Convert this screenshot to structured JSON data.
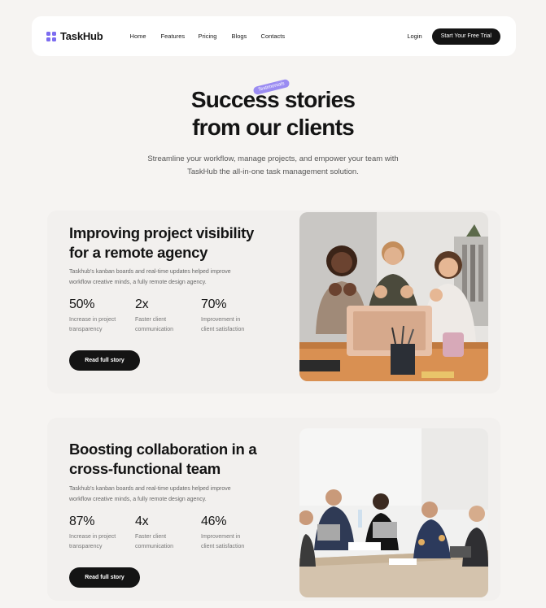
{
  "nav": {
    "logo_text": "TaskHub",
    "links": [
      "Home",
      "Features",
      "Pricing",
      "Blogs",
      "Contacts"
    ],
    "login": "Login",
    "cta": "Start Your Free Trial"
  },
  "hero": {
    "badge": "Testimonials",
    "title_line1": "Success stories",
    "title_line2": "from our clients",
    "subtitle_line1": "Streamline your workflow, manage projects, and empower your team with",
    "subtitle_line2": "TaskHub the all-in-one task management solution."
  },
  "stories": [
    {
      "title_line1": "Improving project visibility",
      "title_line2": "for a remote agency",
      "desc_line1": "Taskhub's kanban boards and real-time updates helped improve",
      "desc_line2": "workflow creative minds, a fully remote design agency.",
      "stats": [
        {
          "value": "50%",
          "label_line1": "Increase in project",
          "label_line2": "transparency"
        },
        {
          "value": "2x",
          "label_line1": "Faster client",
          "label_line2": "communication"
        },
        {
          "value": "70%",
          "label_line1": "Improvement in",
          "label_line2": "client satisfaction"
        }
      ],
      "button": "Read full story",
      "photo": "team-celebrating-laptop-photo"
    },
    {
      "title_line1": "Boosting collaboration in a",
      "title_line2": "cross-functional team",
      "desc_line1": "Taskhub's kanban boards and real-time updates helped improve",
      "desc_line2": "workflow creative minds, a fully remote design agency.",
      "stats": [
        {
          "value": "87%",
          "label_line1": "Increase in project",
          "label_line2": "transparency"
        },
        {
          "value": "4x",
          "label_line1": "Faster client",
          "label_line2": "communication"
        },
        {
          "value": "46%",
          "label_line1": "Improvement in",
          "label_line2": "client satisfaction"
        }
      ],
      "button": "Read full story",
      "photo": "business-meeting-table-photo"
    }
  ],
  "colors": {
    "accent": "#7c6cf0",
    "badge": "#9b8cf2",
    "dark": "#141414",
    "background": "#f6f4f2"
  }
}
